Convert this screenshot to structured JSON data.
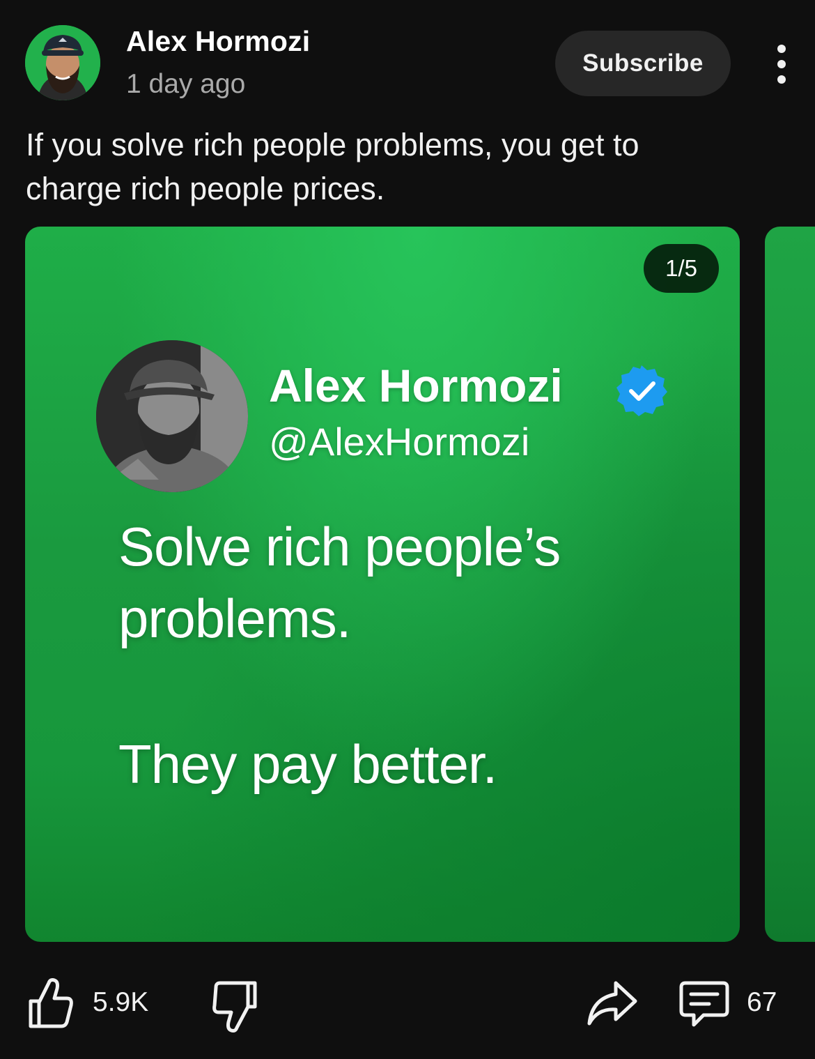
{
  "post": {
    "channel_name": "Alex Hormozi",
    "timestamp": "1 day ago",
    "subscribe_label": "Subscribe",
    "text": "If you solve rich people problems, you get to charge rich people prices."
  },
  "image": {
    "counter": "1/5",
    "tweet": {
      "name": "Alex Hormozi",
      "handle": "@AlexHormozi",
      "line1": "Solve rich people’s problems.",
      "line2": "They pay better."
    }
  },
  "actions": {
    "likes": "5.9K",
    "comments": "67"
  },
  "icons": {
    "menu": "more-vert-icon",
    "like": "thumbs-up-icon",
    "dislike": "thumbs-down-icon",
    "share": "share-icon",
    "comment": "comment-icon",
    "verified": "verified-badge-icon"
  },
  "colors": {
    "background": "#0f0f0f",
    "card_green": "#1a9a3f",
    "verified_blue": "#1d9bf0",
    "avatar_bg": "#22b14c"
  }
}
